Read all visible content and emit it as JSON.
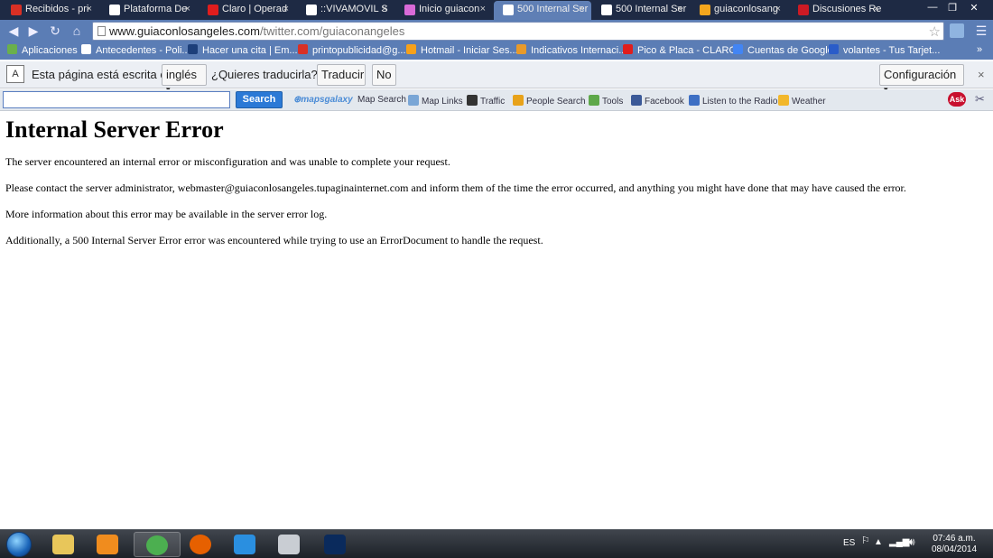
{
  "tabs": [
    {
      "label": "Recibidos - pri",
      "icon": "gmail-icon",
      "color": "#d93025"
    },
    {
      "label": "Plataforma De",
      "icon": "page-icon",
      "color": "#ffffff"
    },
    {
      "label": "Claro | Operad",
      "icon": "claro-icon",
      "color": "#e01d1d"
    },
    {
      "label": "::VIVAMOVIL S",
      "icon": "page-icon",
      "color": "#ffffff"
    },
    {
      "label": "Inicio guiacon",
      "icon": "joomla-icon",
      "color": "#d96ad8"
    },
    {
      "label": "500 Internal Ser",
      "icon": "page-icon",
      "color": "#ffffff"
    },
    {
      "label": "500 Internal Ser",
      "icon": "page-icon",
      "color": "#ffffff"
    },
    {
      "label": "guiaconlosang",
      "icon": "joomla-icon",
      "color": "#f4a61d"
    },
    {
      "label": "Discusiones Re",
      "icon": "site-icon",
      "color": "#cc1a24"
    }
  ],
  "active_tab_index": 5,
  "address": {
    "host": "www.guiaconlosangeles.com",
    "path": "/twitter.com/guiaconangeles"
  },
  "bookmarks": [
    {
      "label": "Aplicaciones",
      "icon": "apps-icon",
      "color": "#6ab04c"
    },
    {
      "label": "Antecedentes - Poli...",
      "icon": "page-icon",
      "color": "#ffffff"
    },
    {
      "label": "Hacer una cita | Em...",
      "icon": "site-icon",
      "color": "#1d3f7a"
    },
    {
      "label": "printopublicidad@g...",
      "icon": "gmail-icon",
      "color": "#d93025"
    },
    {
      "label": "Hotmail - Iniciar Ses...",
      "icon": "windows-icon",
      "color": "#f6a11b"
    },
    {
      "label": "Indicativos Internaci...",
      "icon": "site-icon",
      "color": "#e89a2a"
    },
    {
      "label": "Pico & Placa - CLARO",
      "icon": "claro-icon",
      "color": "#e01d1d"
    },
    {
      "label": "Cuentas de Google",
      "icon": "google-icon",
      "color": "#4285f4"
    },
    {
      "label": "volantes - Tus Tarjet...",
      "icon": "site-icon",
      "color": "#2a5cc9"
    }
  ],
  "translate": {
    "prefix": "Esta página está escrita en",
    "language": "inglés",
    "question": "¿Quieres traducirla?",
    "translate_btn": "Traducir",
    "no_btn": "No",
    "settings_btn": "Configuración"
  },
  "search_toolbar": {
    "button": "Search",
    "links": [
      {
        "label": "Map Search",
        "icon": "mapsgalaxy-icon",
        "color": "#4a8bd6"
      },
      {
        "label": "Map Links",
        "icon": "map-icon",
        "color": "#7aa6d6"
      },
      {
        "label": "Traffic",
        "icon": "traffic-light-icon",
        "color": "#333333"
      },
      {
        "label": "People Search",
        "icon": "people-search-icon",
        "color": "#e8a21a"
      },
      {
        "label": "Tools",
        "icon": "tools-icon",
        "color": "#5ea84a"
      },
      {
        "label": "Facebook",
        "icon": "facebook-icon",
        "color": "#3b5998"
      },
      {
        "label": "Listen to the Radio",
        "icon": "radio-icon",
        "color": "#3d6fc4"
      },
      {
        "label": "Weather",
        "icon": "weather-icon",
        "color": "#f2b72b"
      }
    ],
    "brand": "mapsgalaxy",
    "ask_label": "Ask"
  },
  "page": {
    "title": "Internal Server Error",
    "p1": "The server encountered an internal error or misconfiguration and was unable to complete your request.",
    "p2": "Please contact the server administrator, webmaster@guiaconlosangeles.tupaginainternet.com and inform them of the time the error occurred, and anything you might have done that may have caused the error.",
    "p3": "More information about this error may be available in the server error log.",
    "p4": "Additionally, a 500 Internal Server Error error was encountered while trying to use an ErrorDocument to handle the request."
  },
  "taskbar": {
    "apps": [
      {
        "name": "explorer",
        "icon": "folder-icon",
        "color": "#e8c65a"
      },
      {
        "name": "media-player",
        "icon": "media-player-icon",
        "color": "#f08c1e"
      },
      {
        "name": "chrome",
        "icon": "chrome-icon",
        "color": "#4caf50"
      },
      {
        "name": "firefox",
        "icon": "firefox-icon",
        "color": "#e66000"
      },
      {
        "name": "internet-explorer",
        "icon": "ie-icon",
        "color": "#2a8fe0"
      },
      {
        "name": "scanner",
        "icon": "scanner-icon",
        "color": "#c9cdd3"
      },
      {
        "name": "photoshop",
        "icon": "photoshop-icon",
        "color": "#0a2a5c"
      }
    ],
    "active_app_index": 2,
    "language": "ES",
    "time": "07:46 a.m.",
    "date": "08/04/2014"
  }
}
